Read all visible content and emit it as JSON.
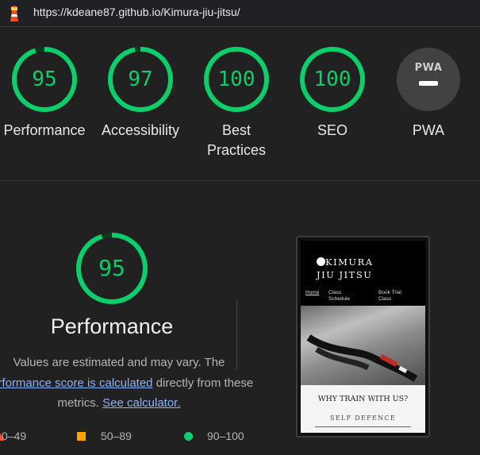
{
  "browser": {
    "url": "https://kdeane87.github.io/Kimura-jiu-jitsu/"
  },
  "gauges": [
    {
      "score": "95",
      "label": "Performance",
      "value": 95
    },
    {
      "score": "97",
      "label": "Accessibility",
      "value": 97
    },
    {
      "score": "100",
      "label": "Best Practices",
      "value": 100
    },
    {
      "score": "100",
      "label": "SEO",
      "value": 100
    },
    {
      "score": "",
      "label": "PWA",
      "badge": "PWA"
    }
  ],
  "colors": {
    "pass": "#0cce6b",
    "average": "#ffa400",
    "fail": "#ff4e42",
    "link": "#8ab4f8"
  },
  "performance": {
    "score": "95",
    "value": 95,
    "title": "Performance",
    "desc_part1": "Values are estimated and may vary. The",
    "desc_link1": "performance score is calculated",
    "desc_part2": "directly from these metrics.",
    "desc_link2": "See calculator."
  },
  "legend": [
    {
      "range": "0–49",
      "shape": "triangle"
    },
    {
      "range": "50–89",
      "shape": "square"
    },
    {
      "range": "90–100",
      "shape": "circle"
    }
  ],
  "thumbnail": {
    "brand_line1": "KIMURA",
    "brand_line2": "JIU JITSU",
    "nav": [
      "Home",
      "Class Schedule",
      "Book Trial Class"
    ],
    "heading": "WHY TRAIN WITH US?",
    "subheading": "SELF DEFENCE"
  }
}
